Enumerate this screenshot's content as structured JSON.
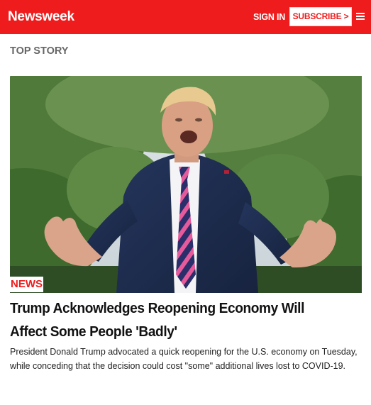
{
  "header": {
    "logo": "Newsweek",
    "sign_in_label": "SIGN IN",
    "subscribe_label": "SUBSCRIBE >",
    "menu_icon": "hamburger-menu-icon",
    "brand_color": "#ee1c1c"
  },
  "section": {
    "label": "TOP STORY"
  },
  "story": {
    "tag": "NEWS",
    "headline": "Trump Acknowledges Reopening Economy Will Affect Some People 'Badly'",
    "summary": "President Donald Trump advocated a quick reopening for the U.S. economy on Tuesday, while conceding that the decision could cost \"some\" additional lives lost to COVID-19."
  }
}
